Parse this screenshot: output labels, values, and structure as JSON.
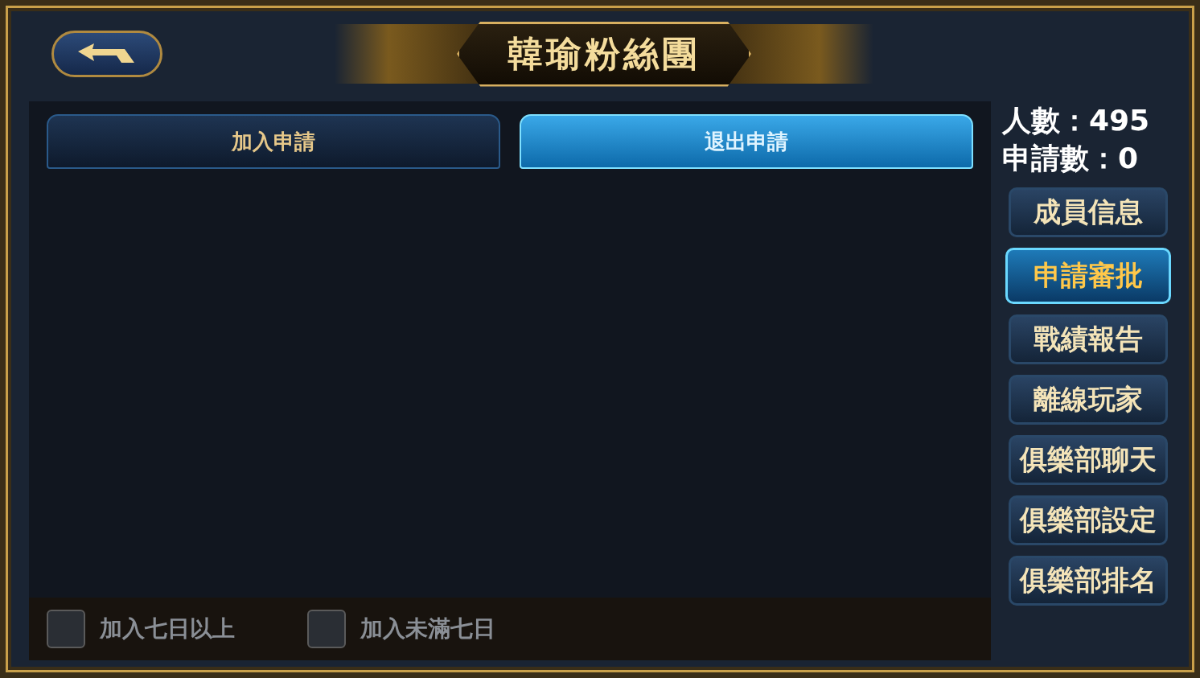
{
  "title": "韓瑜粉絲團",
  "tabs": [
    {
      "label": "加入申請",
      "selected": false
    },
    {
      "label": "退出申請",
      "selected": true
    }
  ],
  "filters": [
    {
      "label": "加入七日以上",
      "checked": false
    },
    {
      "label": "加入未滿七日",
      "checked": false
    }
  ],
  "stats": [
    "人數：495",
    "申請數：0"
  ],
  "menu": [
    {
      "label": "成員信息",
      "selected": false
    },
    {
      "label": "申請審批",
      "selected": true
    },
    {
      "label": "戰績報告",
      "selected": false
    },
    {
      "label": "離線玩家",
      "selected": false
    },
    {
      "label": "俱樂部聊天",
      "selected": false
    },
    {
      "label": "俱樂部設定",
      "selected": false
    },
    {
      "label": "俱樂部排名",
      "selected": false
    }
  ]
}
